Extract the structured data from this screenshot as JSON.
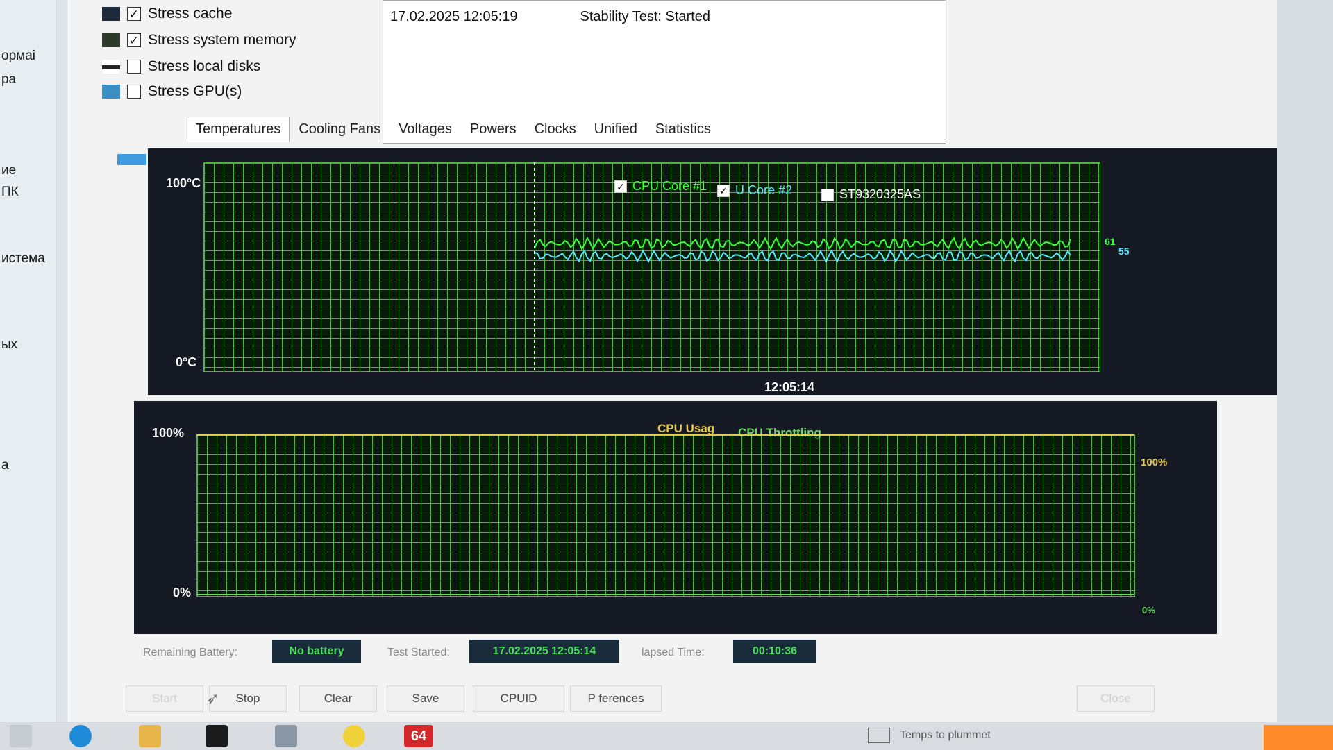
{
  "left_window": {
    "labels": [
      "ормаі",
      "ра",
      "ие",
      "ПК",
      "истема",
      "ых",
      "а"
    ]
  },
  "options": {
    "items": [
      {
        "label": "Stress cache",
        "checked": true
      },
      {
        "label": "Stress system memory",
        "checked": true
      },
      {
        "label": "Stress local disks",
        "checked": false
      },
      {
        "label": "Stress GPU(s)",
        "checked": false
      }
    ]
  },
  "log": {
    "entries": [
      {
        "datetime": "17.02.2025 12:05:19",
        "status": "Stability Test: Started"
      }
    ]
  },
  "tabs": [
    "Temperatures",
    "Cooling Fans",
    "Voltages",
    "Powers",
    "Clocks",
    "Unified",
    "Statistics"
  ],
  "active_tab": "Temperatures",
  "temp_chart": {
    "y_top": "100°C",
    "y_bottom": "0°C",
    "x_time": "12:05:14",
    "legend": [
      {
        "label": "CPU Core #1",
        "checked": true,
        "color": "#3cff3c"
      },
      {
        "label": "U Core #2",
        "checked": true,
        "color": "#58e8ff"
      },
      {
        "label": "ST9320325AS",
        "checked": false,
        "color": "#ffffff"
      }
    ],
    "end_labels": [
      {
        "text": "61",
        "color": "#3cff3c"
      },
      {
        "text": "55",
        "color": "#58e8ff"
      }
    ]
  },
  "chart_data": [
    {
      "type": "line",
      "ylim": [
        0,
        100
      ],
      "series": [
        {
          "name": "CPU Core #1",
          "approx_value": 61,
          "start_fraction": 0.37
        },
        {
          "name": "U Core #2",
          "approx_value": 55,
          "start_fraction": 0.37
        }
      ]
    },
    {
      "type": "line",
      "ylim": [
        0,
        100
      ],
      "series": [
        {
          "name": "CPU Usag",
          "values": [
            100,
            100,
            100,
            100,
            100
          ]
        },
        {
          "name": "CPU Throttling",
          "values": [
            0,
            0,
            0,
            0,
            0
          ]
        }
      ]
    }
  ],
  "usage_chart": {
    "y_top": "100%",
    "y_bottom": "0%",
    "usage_label": "CPU Usag",
    "throttle_label": "CPU Throttling",
    "right_top": "100%",
    "right_bottom": "0%",
    "colors": {
      "usage": "#e6c84a",
      "throttle": "#6fd56a"
    }
  },
  "status": {
    "battery_label": "Remaining Battery:",
    "battery_value": "No battery",
    "started_label": "Test Started:",
    "started_value": "17.02.2025 12:05:14",
    "elapsed_label": "lapsed Time:",
    "elapsed_value": "00:10:36"
  },
  "buttons": {
    "start": "Start",
    "stop": "Stop",
    "clear": "Clear",
    "save": "Save",
    "cpuid": "CPUID",
    "preferences": "P   ferences",
    "close": "Close"
  },
  "taskbar": {
    "aida_label": "64",
    "tray_text": "Temps to plummet"
  }
}
